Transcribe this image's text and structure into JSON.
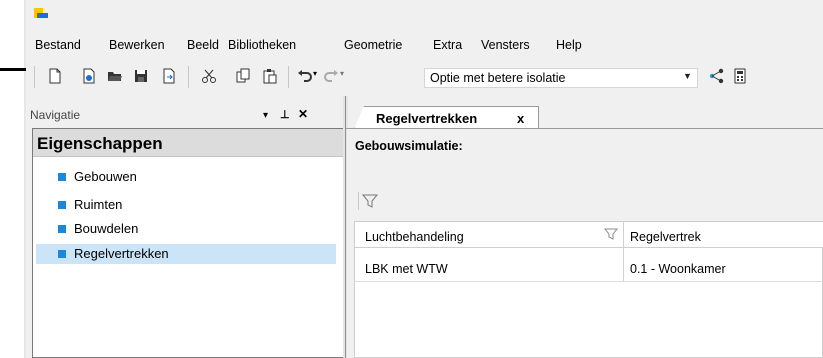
{
  "app": {
    "icon": "app-logo-icon"
  },
  "menu": {
    "items": [
      "Bestand",
      "Bewerken",
      "Beeld",
      "Bibliotheken",
      "Geometrie",
      "Extra",
      "Vensters",
      "Help"
    ]
  },
  "toolbar": {
    "option_select": {
      "value": "Optie met betere isolatie"
    },
    "icons": [
      "new-file-icon",
      "new-project-icon",
      "open-folder-icon",
      "save-icon",
      "export-icon",
      "cut-icon",
      "copy-icon",
      "paste-icon",
      "undo-icon",
      "redo-icon",
      "share-icon",
      "calculator-icon"
    ]
  },
  "navigation": {
    "panel_title": "Navigatie",
    "pin_glyph": "▾  1  ✕",
    "heading": "Eigenschappen",
    "items": [
      {
        "label": "Gebouwen",
        "selected": false
      },
      {
        "label": "Ruimten",
        "selected": false
      },
      {
        "label": "Bouwdelen",
        "selected": false
      },
      {
        "label": "Regelvertrekken",
        "selected": true
      }
    ],
    "bullet_color": "#1e88d8",
    "selected_bg": "#cce4f7"
  },
  "document": {
    "tab": {
      "label": "Regelvertrekken",
      "close": "x"
    },
    "section_label": "Gebouwsimulatie:",
    "grid": {
      "columns": [
        "Luchtbehandeling",
        "Regelvertrek"
      ],
      "rows": [
        [
          "LBK met WTW",
          "0.1 - Woonkamer"
        ]
      ]
    }
  }
}
